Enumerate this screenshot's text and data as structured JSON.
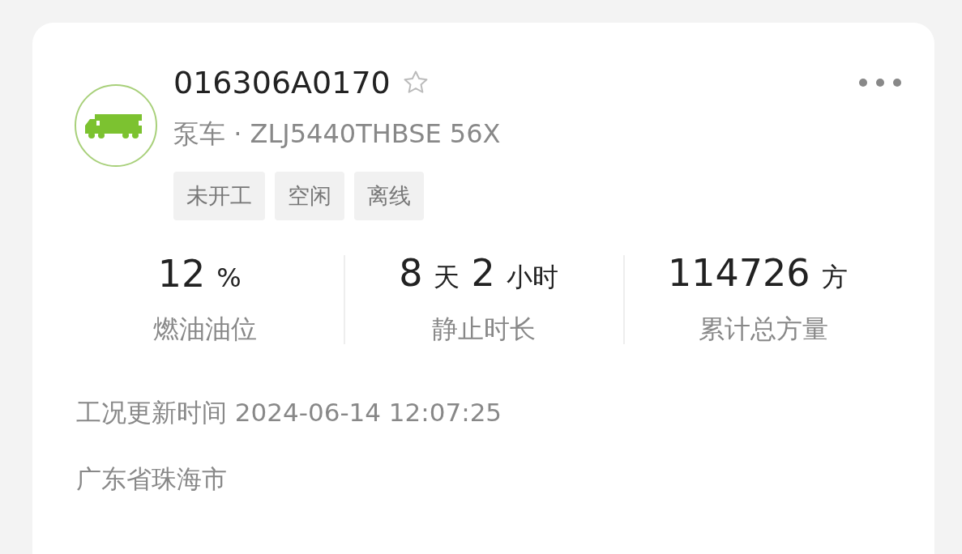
{
  "device": {
    "id": "016306A0170",
    "starred": false,
    "subtitle": "泵车 · ZLJ5440THBSE 56X"
  },
  "tags": [
    "未开工",
    "空闲",
    "离线"
  ],
  "stats": [
    {
      "value": "12",
      "unit": "%",
      "label": "燃油油位"
    },
    {
      "value": "8",
      "unit": "天",
      "value2": "2",
      "unit2": "小时",
      "label": "静止时长"
    },
    {
      "value": "114726",
      "unit": "方",
      "label": "累计总方量"
    }
  ],
  "updated": "工况更新时间 2024-06-14 12:07:25",
  "address": "广东省珠海市"
}
